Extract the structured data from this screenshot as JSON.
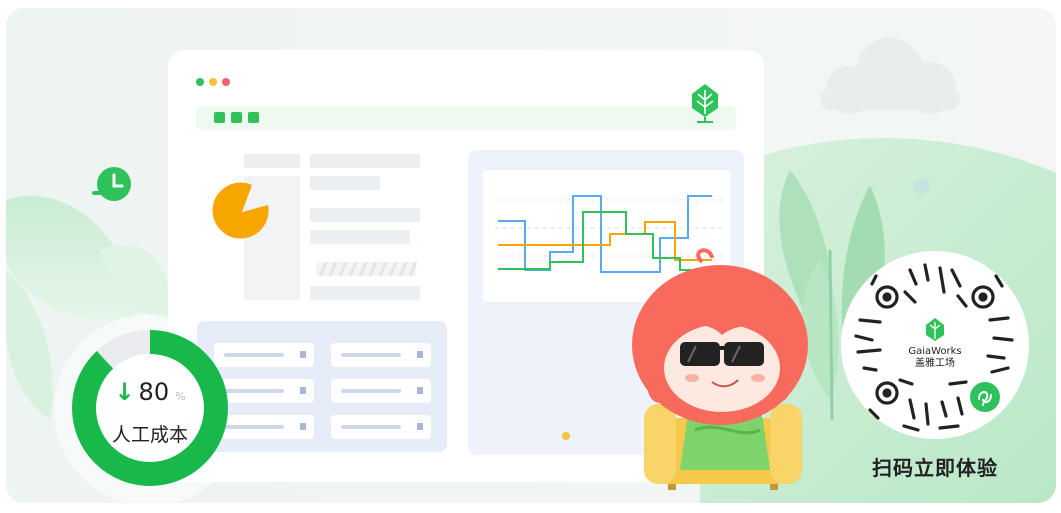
{
  "banner": {
    "gauge": {
      "arrow": "↓",
      "value": "80",
      "unit": "%",
      "label": "人工成本",
      "level_percent": 88
    },
    "qr": {
      "brand_name": "GaiaWorks",
      "brand_cn": "盖雅工场",
      "caption": "扫码立即体验"
    },
    "colors": {
      "green": "#19b84a",
      "orange": "#f7a600",
      "blue": "#5aa8f0",
      "coral": "#f86a5c"
    },
    "icons": [
      "tree-logo-icon",
      "clock-icon",
      "mini-program-icon",
      "pie-chart-icon"
    ]
  }
}
